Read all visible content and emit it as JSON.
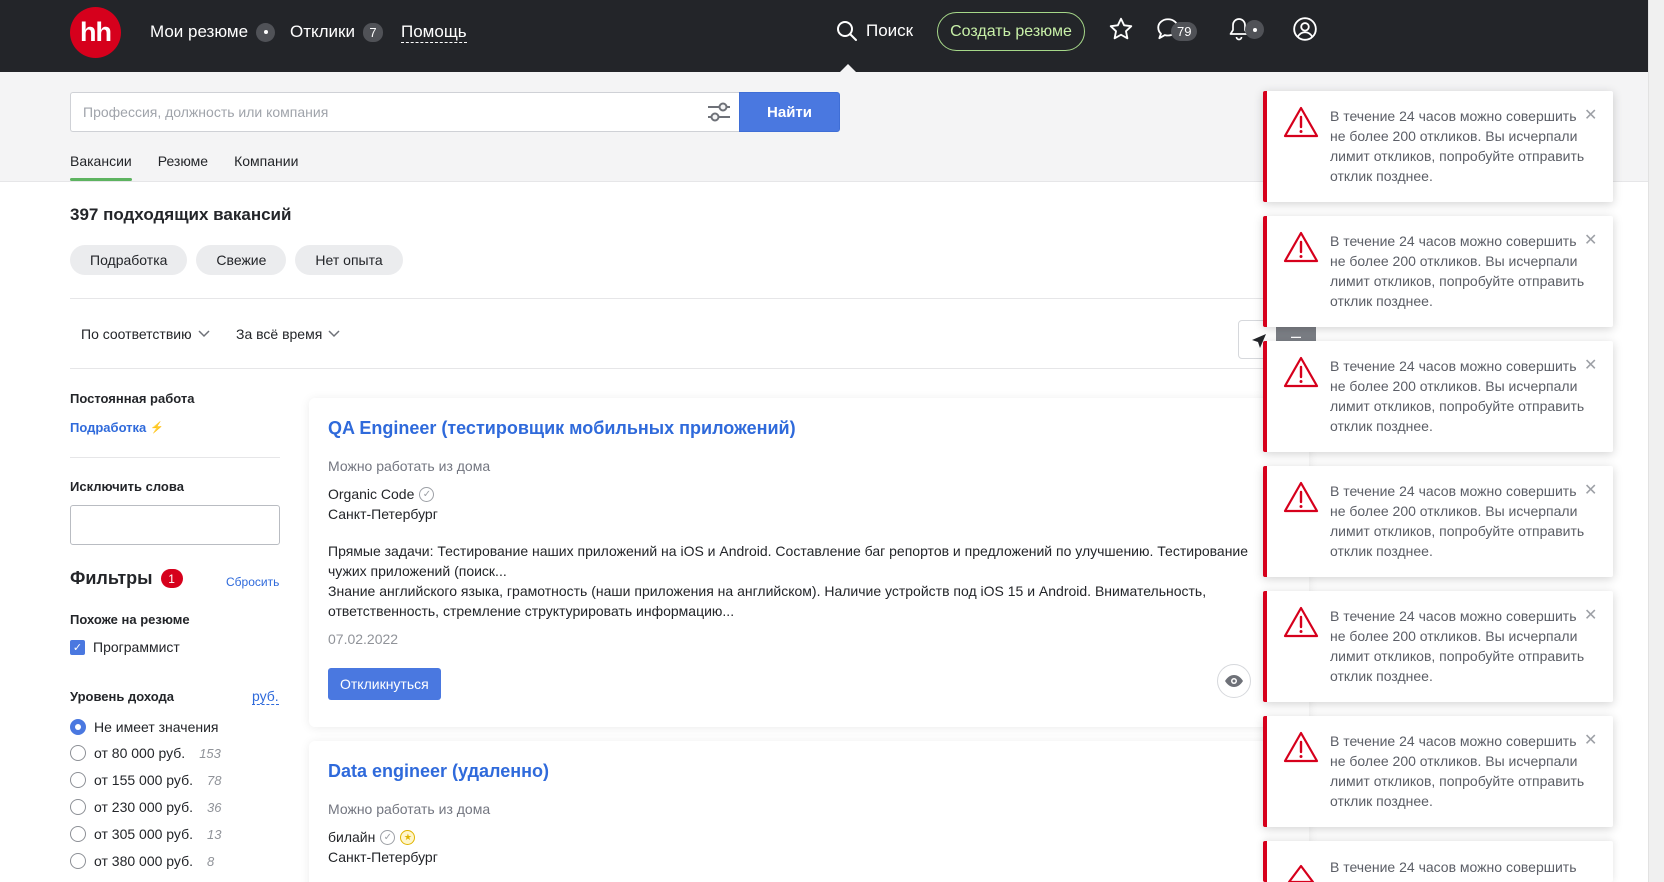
{
  "header": {
    "logo": "hh",
    "nav": [
      {
        "label": "Мои резюме"
      },
      {
        "label": "Отклики",
        "badge": "7"
      },
      {
        "label": "Помощь"
      }
    ],
    "search_label": "Поиск",
    "create_resume_label": "Создать резюме",
    "messages_count": "79"
  },
  "search": {
    "placeholder": "Профессия, должность или компания",
    "find_label": "Найти",
    "tabs": [
      {
        "label": "Вакансии",
        "active": true
      },
      {
        "label": "Резюме",
        "active": false
      },
      {
        "label": "Компании",
        "active": false
      }
    ]
  },
  "results": {
    "title": "397 подходящих вакансий",
    "chips": [
      "Подработка",
      "Свежие",
      "Нет опыта"
    ],
    "sort_relevance": "По соответствию",
    "sort_period": "За всё время",
    "map_minus": "–"
  },
  "sidebar": {
    "employment_heading": "Постоянная работа",
    "parttime_link": "Подработка",
    "exclude_heading": "Исключить слова",
    "filters_title": "Фильтры",
    "filters_count": "1",
    "reset_label": "Сбросить",
    "similar_heading": "Похоже на резюме",
    "similar_checkbox": "Программист",
    "income_heading": "Уровень дохода",
    "currency_link": "руб.",
    "income_options": [
      {
        "label": "Не имеет значения",
        "count": "",
        "selected": true
      },
      {
        "label": "от 80 000 руб.",
        "count": "153",
        "selected": false
      },
      {
        "label": "от 155 000 руб.",
        "count": "78",
        "selected": false
      },
      {
        "label": "от 230 000 руб.",
        "count": "36",
        "selected": false
      },
      {
        "label": "от 305 000 руб.",
        "count": "13",
        "selected": false
      },
      {
        "label": "от 380 000 руб.",
        "count": "8",
        "selected": false
      }
    ]
  },
  "vacancies": [
    {
      "title": "QA Engineer (тестировщик мобильных приложений)",
      "remote": "Можно работать из дома",
      "company": "Organic Code",
      "city": "Санкт-Петербург",
      "desc1": "Прямые задачи: Тестирование наших приложений на iOS и Android. Составление баг репортов и предложений по улучшению. Тестирование чужих приложений (поиск...",
      "desc2": "Знание английского языка, грамотность (наши приложения на английском). Наличие устройств под iOS 15 и Android. Внимательность, ответственность, стремление структурировать информацию...",
      "date": "07.02.2022",
      "respond_label": "Откликнуться"
    },
    {
      "title": "Data engineer (удаленно)",
      "remote": "Можно работать из дома",
      "company": "билайн",
      "city": "Санкт-Петербург"
    }
  ],
  "notifications": [
    {
      "text": "В течение 24 часов можно совершить не более 200 откликов. Вы исчерпали лимит откликов, попробуйте отправить отклик позднее."
    },
    {
      "text": "В течение 24 часов можно совершить не более 200 откликов. Вы исчерпали лимит откликов, попробуйте отправить отклик позднее."
    },
    {
      "text": "В течение 24 часов можно совершить не более 200 откликов. Вы исчерпали лимит откликов, попробуйте отправить отклик позднее."
    },
    {
      "text": "В течение 24 часов можно совершить не более 200 откликов. Вы исчерпали лимит откликов, попробуйте отправить отклик позднее."
    },
    {
      "text": "В течение 24 часов можно совершить не более 200 откликов. Вы исчерпали лимит откликов, попробуйте отправить отклик позднее."
    },
    {
      "text": "В течение 24 часов можно совершить не более 200 откликов. Вы исчерпали лимит откликов, попробуйте отправить отклик позднее."
    },
    {
      "text": "В течение 24 часов можно совершить"
    }
  ],
  "colors": {
    "header_bg": "#232529",
    "brand_red": "#d6001c",
    "link_blue": "#2f6adb",
    "button_blue": "#4a78e0",
    "accent_green": "#5db360"
  }
}
